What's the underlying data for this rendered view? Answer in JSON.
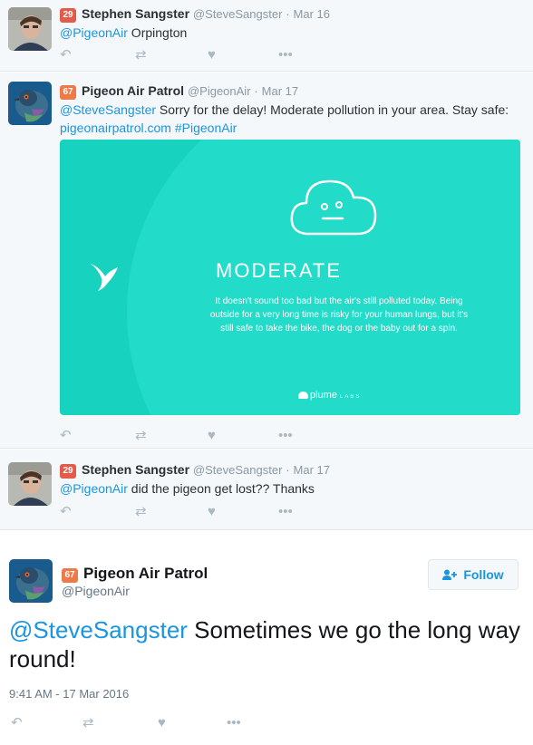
{
  "tweets": [
    {
      "score": "29",
      "name": "Stephen Sangster",
      "handle": "@SteveSangster",
      "dot": "·",
      "date": "Mar 16",
      "mention": "@PigeonAir",
      "text": " Orpington"
    },
    {
      "score": "67",
      "name": "Pigeon Air Patrol",
      "handle": "@PigeonAir",
      "dot": "·",
      "date": "Mar 17",
      "mention": "@SteveSangster",
      "text": " Sorry for the delay! Moderate pollution in your area. Stay safe: ",
      "link": "pigeonairpatrol.com",
      "hashtag": " #PigeonAir"
    },
    {
      "score": "29",
      "name": "Stephen Sangster",
      "handle": "@SteveSangster",
      "dot": "·",
      "date": "Mar 17",
      "mention": "@PigeonAir",
      "text": " did the pigeon get lost?? Thanks"
    }
  ],
  "card": {
    "title": "MODERATE",
    "body": "It doesn't sound too bad but the air's still polluted today. Being outside for a very long time is risky for your human lungs, but it's still safe to take the bike, the dog or the baby out for a spin.",
    "brand": "plume",
    "brand_suffix": "LABS",
    "colors": {
      "bg": "#16d2be",
      "circle": "#22dbc8"
    }
  },
  "main_tweet": {
    "score": "67",
    "name": "Pigeon Air Patrol",
    "handle": "@PigeonAir",
    "follow_label": "Follow",
    "mention": "@SteveSangster",
    "text": " Sometimes we go the long way round!",
    "timestamp": "9:41 AM - 17 Mar 2016"
  },
  "icons": {
    "reply": "reply-icon",
    "retweet": "retweet-icon",
    "like": "heart-icon",
    "more": "more-icon"
  },
  "colors": {
    "link": "#1b95e0",
    "muted": "#8899a6",
    "badge_red": "#e45b4a",
    "badge_orange": "#ee7a49"
  }
}
